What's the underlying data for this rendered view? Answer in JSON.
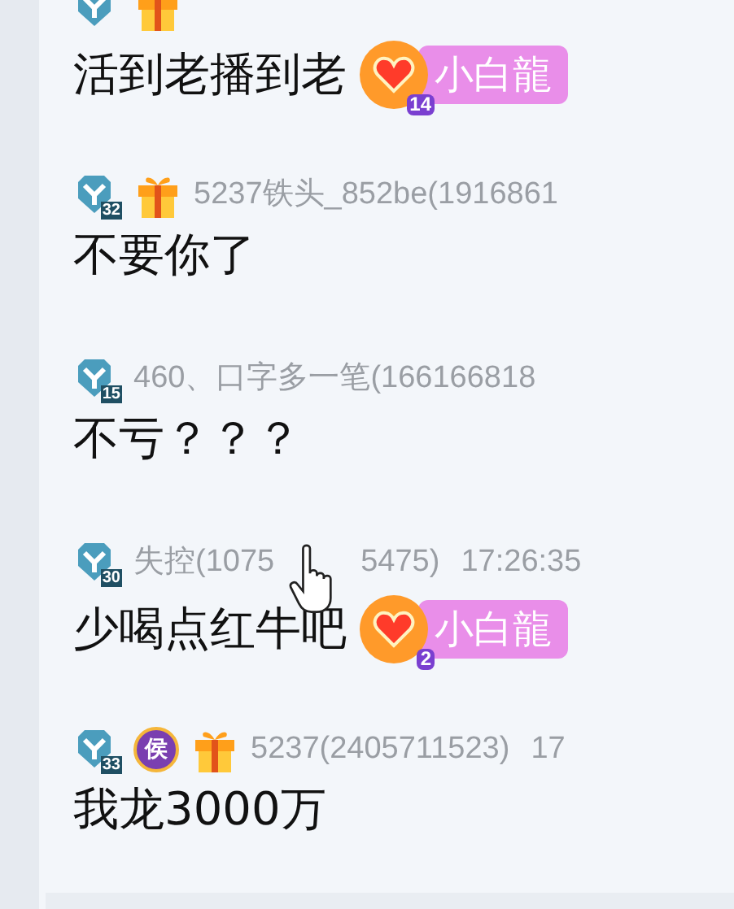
{
  "messages": [
    {
      "badges": [
        {
          "kind": "level"
        },
        {
          "kind": "gift"
        }
      ],
      "text": "活到老播到老",
      "fan_badge": {
        "level": "14",
        "label": "小白龍"
      }
    },
    {
      "badges": [
        {
          "kind": "level",
          "number": "32"
        },
        {
          "kind": "gift"
        }
      ],
      "name": "5237铁头_852be(1916861",
      "text": "不要你了"
    },
    {
      "badges": [
        {
          "kind": "level",
          "number": "15"
        }
      ],
      "name": "460、口字多一笔(166166818",
      "text": "不亏？？？"
    },
    {
      "badges": [
        {
          "kind": "level",
          "number": "30"
        }
      ],
      "name": "失控(1075",
      "name_after_cursor": "5475)",
      "time": "17:26:35",
      "text": "少喝点红牛吧",
      "fan_badge": {
        "level": "2",
        "label": "小白龍"
      }
    },
    {
      "badges": [
        {
          "kind": "level",
          "number": "33"
        },
        {
          "kind": "noble",
          "label": "侯"
        },
        {
          "kind": "gift"
        }
      ],
      "name": "5237(2405711523)",
      "time": "17",
      "text": "我龙3000万"
    }
  ]
}
